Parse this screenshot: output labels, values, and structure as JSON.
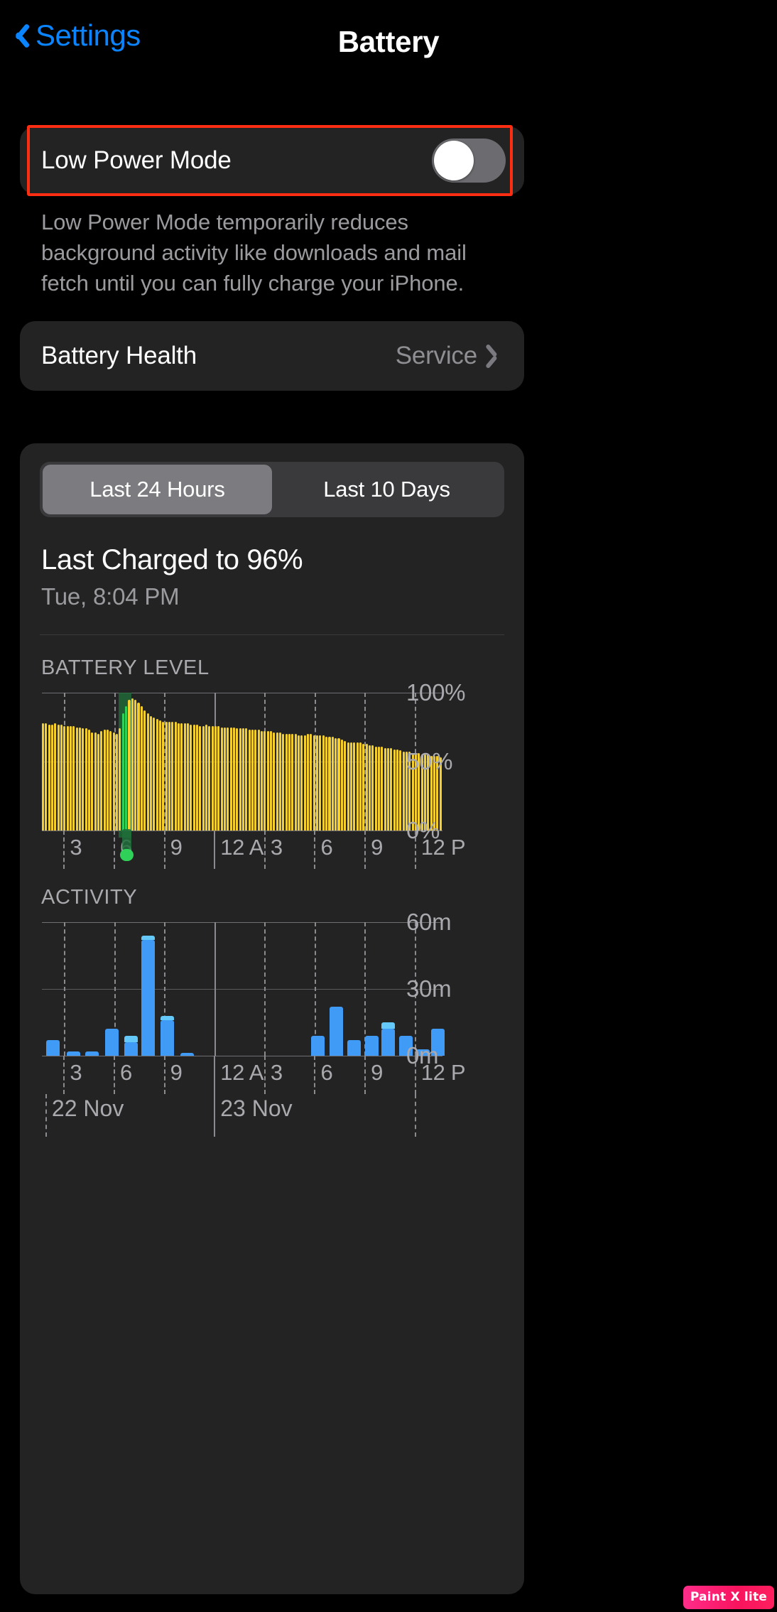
{
  "nav": {
    "back_label": "Settings",
    "title": "Battery"
  },
  "low_power_mode": {
    "label": "Low Power Mode",
    "enabled": false,
    "footnote": "Low Power Mode temporarily reduces background activity like downloads and mail fetch until you can fully charge your iPhone."
  },
  "battery_health": {
    "label": "Battery Health",
    "value": "Service"
  },
  "usage": {
    "segments": [
      {
        "label": "Last 24 Hours",
        "selected": true
      },
      {
        "label": "Last 10 Days",
        "selected": false
      }
    ],
    "last_charged_title": "Last Charged to 96%",
    "last_charged_sub": "Tue, 8:04 PM",
    "battery_level_label": "BATTERY LEVEL",
    "activity_label": "ACTIVITY",
    "day_labels": [
      "22 Nov",
      "23 Nov"
    ]
  },
  "colors": {
    "accent_blue": "#0a84ff",
    "battery_yellow": "#f5d02d",
    "charging_green": "#30d158",
    "charging_band": "#206e3a",
    "activity_blue": "#3f9bf5",
    "activity_cap": "#64c8f8",
    "highlight_red": "#ff2d11",
    "card_bg": "#232323",
    "segment_bg": "#3a3a3c",
    "segment_active": "#7c7c80"
  },
  "watermark": {
    "text": "Paint X lite"
  },
  "chart_data": [
    {
      "type": "bar",
      "id": "battery-level",
      "title": "BATTERY LEVEL",
      "ylabel": "",
      "xlabel": "",
      "ylim": [
        0,
        100
      ],
      "yticks": [
        0,
        50,
        100
      ],
      "ytick_labels": [
        "0%",
        "50%",
        "100%"
      ],
      "grid": true,
      "xtick_labels": [
        "3",
        "6",
        "9",
        "12 A",
        "3",
        "6",
        "9",
        "12 P"
      ],
      "xtick_positions": [
        0.0555,
        0.1805,
        0.3055,
        0.4305,
        0.5555,
        0.6805,
        0.8055,
        0.9305
      ],
      "xtick_solid_index": 3,
      "bar_color": "#f5d02d",
      "charging_color": "#30d158",
      "charging_band_start_index": 25,
      "charging_band_end_index": 29,
      "charging_bar_indices": [
        26,
        27
      ],
      "values": [
        78,
        78,
        77,
        77,
        78,
        77,
        77,
        76,
        76,
        76,
        76,
        75,
        75,
        74,
        74,
        73,
        71,
        71,
        70,
        72,
        73,
        73,
        72,
        71,
        70,
        74,
        85,
        90,
        95,
        96,
        95,
        93,
        90,
        87,
        85,
        83,
        82,
        81,
        80,
        79,
        79,
        79,
        79,
        79,
        78,
        78,
        78,
        78,
        77,
        77,
        77,
        76,
        76,
        77,
        76,
        76,
        76,
        76,
        75,
        75,
        75,
        75,
        75,
        74,
        74,
        74,
        74,
        73,
        73,
        73,
        73,
        72,
        72,
        72,
        72,
        71,
        71,
        71,
        70,
        70,
        70,
        70,
        70,
        69,
        69,
        69,
        70,
        70,
        69,
        69,
        69,
        69,
        68,
        68,
        68,
        67,
        67,
        66,
        65,
        64,
        64,
        64,
        64,
        64,
        63,
        63,
        62,
        62,
        61,
        61,
        61,
        60,
        60,
        60,
        59,
        59,
        58,
        57,
        57,
        57,
        56,
        56,
        56,
        55,
        55,
        55,
        54,
        54,
        54,
        53
      ]
    },
    {
      "type": "bar",
      "id": "activity",
      "title": "ACTIVITY",
      "ylabel": "",
      "xlabel": "",
      "ylim": [
        0,
        60
      ],
      "yticks": [
        0,
        30,
        60
      ],
      "ytick_labels": [
        "0m",
        "30m",
        "60m"
      ],
      "grid": true,
      "xtick_labels": [
        "3",
        "6",
        "9",
        "12 A",
        "3",
        "6",
        "9",
        "12 P"
      ],
      "xtick_positions": [
        0.0555,
        0.1805,
        0.3055,
        0.4305,
        0.5555,
        0.6805,
        0.8055,
        0.9305
      ],
      "xtick_solid_index": 3,
      "bar_color": "#3f9bf5",
      "cap_color": "#64c8f8",
      "bars": [
        {
          "x": 0.01,
          "w": 0.034,
          "value": 7,
          "cap": 0
        },
        {
          "x": 0.062,
          "w": 0.034,
          "value": 2,
          "cap": 0
        },
        {
          "x": 0.108,
          "w": 0.034,
          "value": 2,
          "cap": 0
        },
        {
          "x": 0.158,
          "w": 0.034,
          "value": 12,
          "cap": 0
        },
        {
          "x": 0.205,
          "w": 0.034,
          "value": 6,
          "cap": 3
        },
        {
          "x": 0.248,
          "w": 0.034,
          "value": 52,
          "cap": 2
        },
        {
          "x": 0.296,
          "w": 0.034,
          "value": 16,
          "cap": 2
        },
        {
          "x": 0.345,
          "w": 0.034,
          "value": 1,
          "cap": 0
        },
        {
          "x": 0.672,
          "w": 0.034,
          "value": 9,
          "cap": 0
        },
        {
          "x": 0.718,
          "w": 0.034,
          "value": 22,
          "cap": 0
        },
        {
          "x": 0.762,
          "w": 0.034,
          "value": 7,
          "cap": 0
        },
        {
          "x": 0.806,
          "w": 0.034,
          "value": 9,
          "cap": 0
        },
        {
          "x": 0.848,
          "w": 0.034,
          "value": 12,
          "cap": 3
        },
        {
          "x": 0.892,
          "w": 0.034,
          "value": 9,
          "cap": 0
        },
        {
          "x": 0.934,
          "w": 0.034,
          "value": 3,
          "cap": 0
        },
        {
          "x": 0.972,
          "w": 0.034,
          "value": 12,
          "cap": 0
        }
      ]
    }
  ]
}
